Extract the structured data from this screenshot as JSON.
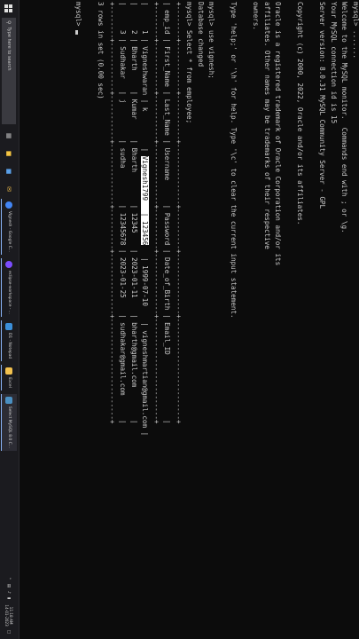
{
  "console": {
    "lines": [
      {
        "text": "mysql> ......."
      },
      {
        "text": "Welcome to the MySQL monitor.  Commands end with ; or \\g."
      },
      {
        "text": "Your MySQL connection id is 15"
      },
      {
        "text": "Server version: 8.0.31 MySQL Community Server - GPL"
      },
      {
        "text": ""
      },
      {
        "text": "Copyright (c) 2000, 2022, Oracle and/or its affiliates."
      },
      {
        "text": ""
      },
      {
        "text": "Oracle is a registered trademark of Oracle Corporation and/or its"
      },
      {
        "text": "affiliates. Other names may be trademarks of their respective"
      },
      {
        "text": "owners."
      },
      {
        "text": ""
      },
      {
        "text": "Type 'help;' or '\\h' for help. Type '\\c' to clear the current input statement."
      },
      {
        "text": ""
      },
      {
        "text": "mysql> use vignesh;"
      },
      {
        "text": "Database changed"
      },
      {
        "text": "mysql> Select * from employee;"
      },
      {
        "text": "+--------+------------+-----------+---------------+----------+---------------+-------------------------+"
      },
      {
        "text": "| emp_id | First_Name | Last_Name | Username      | Password | Date_of_Birth | Email_ID                |"
      },
      {
        "text": "+--------+------------+-----------+---------------+----------+---------------+-------------------------+"
      },
      {
        "pre": "|      1 | Vigneshwaran | k         | ",
        "hl": "Vignesh1799   | 123456",
        "post": "   | 1999-07-10    | vigneshmartian@gmail.com |"
      },
      {
        "text": "|      2 | Bharth     | Kumar     | Bharth        | 12345    | 2023-01-11    | bharth@gmail.com        |"
      },
      {
        "text": "|      3 | Sudhakar   | j         | sudha         | 12345678 | 2023-01-25    | sudhakar@gmail.com      |"
      },
      {
        "text": "+--------+------------+-----------+---------------+----------+---------------+-------------------------+"
      },
      {
        "text": "3 rows in set (0.00 sec)"
      },
      {
        "text": ""
      },
      {
        "text": "mysql> "
      }
    ]
  },
  "taskbar": {
    "search_placeholder": "Type here to search",
    "apps": [
      {
        "label": "Vignesh - Google C...",
        "color": "#4285f4"
      },
      {
        "label": "eclipse-workspace - ...",
        "color": "#7c4dff"
      },
      {
        "label": "D1 - Notepad",
        "color": "#3b8ed8"
      },
      {
        "label": "Excel",
        "color": "#f2c14e"
      },
      {
        "label": "Select MySQL 8.0 C...",
        "color": "#4a90c2"
      }
    ],
    "tray": {
      "time": "11:18 AM",
      "date": "14-01-2023"
    }
  }
}
